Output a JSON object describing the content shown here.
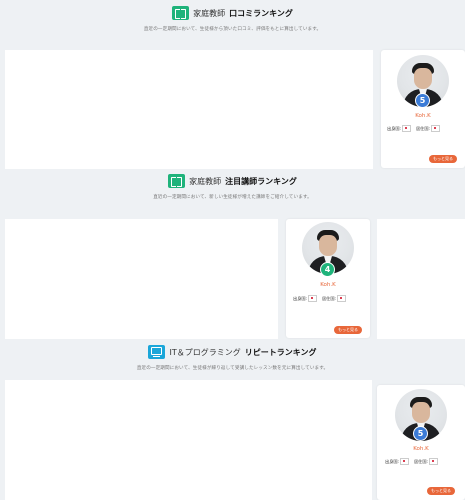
{
  "colors": {
    "green_accent": "#1fb37b",
    "blue_accent": "#1aa6d9",
    "orange": "#e8673a"
  },
  "sections": [
    {
      "icon": "book-icon",
      "title_prefix": "家庭教師",
      "title_main": "口コミランキング",
      "subtitle": "直近の一定期間において、生徒様から頂いた口コミ、評価をもとに算出しています。",
      "card": {
        "rank": "5",
        "name": "Koh.K",
        "birth_label": "出身国:",
        "residence_label": "居住国:",
        "more": "もっと見る"
      }
    },
    {
      "icon": "book-icon",
      "title_prefix": "家庭教師",
      "title_main": "注目講師ランキング",
      "subtitle": "直近の一定期間において、新しい生徒様が増えた講師をご紹介しています。",
      "card": {
        "rank": "4",
        "name": "Koh.K",
        "birth_label": "出身国:",
        "residence_label": "居住国:",
        "more": "もっと見る"
      }
    },
    {
      "icon": "computer-icon",
      "title_prefix": "IT＆プログラミング",
      "title_main": "リピートランキング",
      "subtitle": "直近の一定期間において、生徒様が繰り返して受講したレッスン数を元に算出しています。",
      "card": {
        "rank": "5",
        "name": "Koh.K",
        "birth_label": "出身国:",
        "residence_label": "居住国:",
        "more": "もっと見る"
      }
    }
  ]
}
